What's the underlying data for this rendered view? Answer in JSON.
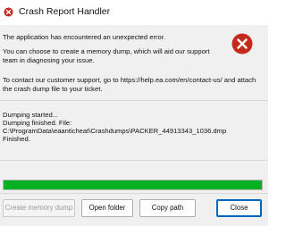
{
  "window": {
    "title": "Crash Report Handler",
    "icon": "error-x-icon"
  },
  "message": {
    "line1": "The application has encountered an unexpected error.",
    "line2a": "You can choose to create a memory dump, which will aid our support",
    "line2b": "team in diagnosing your issue.",
    "line3a": "To contact our customer support, go to https://help.ea.com/en/contact-us/ and attach",
    "line3b": "the crash dump file to your ticket.",
    "icon": "error-icon"
  },
  "log": {
    "lines": [
      "Dumping started...",
      "Dumping finished. File:",
      "C:\\ProgramData\\eaanticheat\\Crashdumps\\PACKER_44913343_1036.dmp",
      "Finished."
    ]
  },
  "progress": {
    "value": 1.0
  },
  "buttons": {
    "create_memory_dump": "Create memory dump",
    "open_folder": "Open folder",
    "copy_path": "Copy path",
    "close": "Close"
  },
  "colors": {
    "error_red": "#c42b1c",
    "progress_green": "#06b025",
    "focus_blue": "#0067c0"
  }
}
